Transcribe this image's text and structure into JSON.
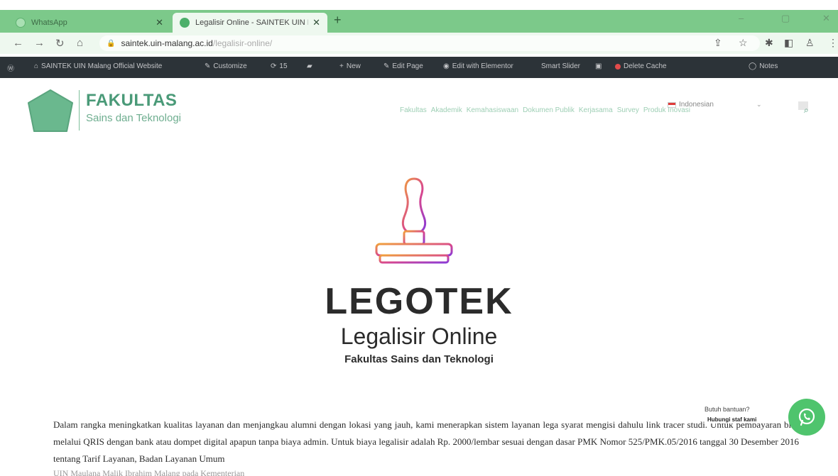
{
  "browser": {
    "tabs": [
      {
        "title": "WhatsApp",
        "close": "✕"
      },
      {
        "title": "Legalisir Online - SAINTEK UIN I",
        "close": "✕"
      }
    ],
    "new_tab": "+",
    "window_controls": {
      "minimize": "–",
      "maximize": "▢",
      "close": "✕"
    },
    "url_host": "saintek.uin-malang.ac.id",
    "url_path": "/legalisir-online/"
  },
  "wp_admin_bar": {
    "site_name": "SAINTEK UIN Malang Official Website",
    "customize": "Customize",
    "updates_count": "15",
    "new": "New",
    "edit_page": "Edit Page",
    "edit_elementor": "Edit with Elementor",
    "smart_slider": "Smart Slider",
    "delete_cache": "Delete Cache",
    "notes": "Notes"
  },
  "header": {
    "logo_title": "FAKULTAS",
    "logo_subtitle": "Sains dan Teknologi",
    "language": "Indonesian",
    "nav": [
      "Fakultas",
      "Akademik",
      "Kemahasiswaan",
      "Dokumen Publik",
      "Kerjasama",
      "Survey",
      "Produk Inovasi"
    ]
  },
  "hero": {
    "title": "LEGOTEK",
    "subtitle": "Legalisir Online",
    "faculty": "Fakultas Sains dan Teknologi"
  },
  "content": {
    "paragraph": "Dalam rangka meningkatkan kualitas layanan dan menjangkau alumni dengan lokasi yang jauh, kami menerapkan sistem layanan lega syarat mengisi dahulu link tracer studi. Untuk pembayaran bisa melalui QRIS dengan bank atau dompet digital apapun tanpa biaya admin. Untuk biaya legalisir adalah Rp. 2000/lembar sesuai dengan dasar PMK Nomor 525/PMK.05/2016 tanggal 30 Desember 2016 tentang Tarif Layanan, Badan Layanan Umum",
    "paragraph_cut": "UIN Maulana Malik Ibrahim Malang pada Kementerian Agama."
  },
  "chat": {
    "label": "Butuh bantuan?",
    "bubble": "Hubungi staf kami"
  },
  "colors": {
    "tabbar": "#7cc98a",
    "brand_green": "#4a9a78",
    "whatsapp": "#4fc46d",
    "wpbar": "#2c3338"
  }
}
